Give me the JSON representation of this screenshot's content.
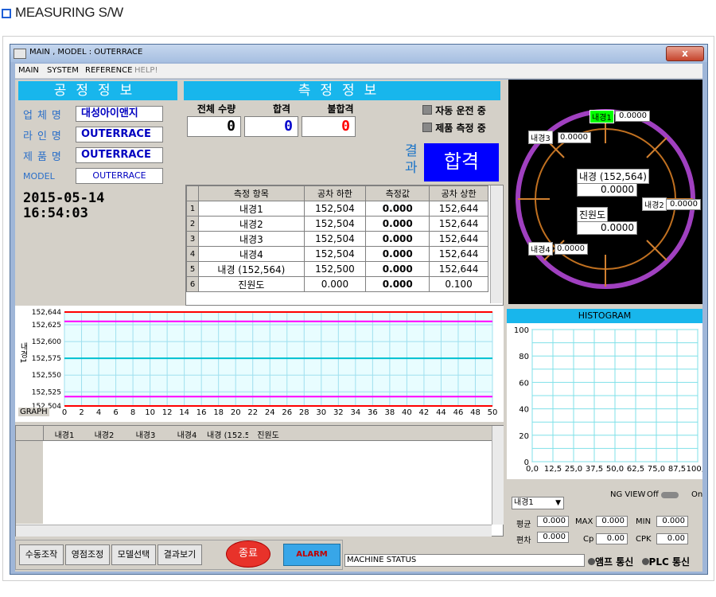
{
  "page_heading": "MEASURING S/W",
  "window": {
    "title": "MAIN ,     MODEL : OUTERRACE",
    "close": "x"
  },
  "menu": [
    "MAIN",
    "SYSTEM",
    "REFERENCE",
    "HELP!"
  ],
  "process_info": {
    "header": "공정정보",
    "rows": [
      {
        "label": "업체명",
        "value": "대성아이앤지"
      },
      {
        "label": "라인명",
        "value": "OUTERRACE"
      },
      {
        "label": "제품명",
        "value": "OUTERRACE"
      },
      {
        "label": "MODEL",
        "value": "OUTERRACE"
      }
    ],
    "date": "2015-05-14",
    "time": "16:54:03"
  },
  "measure_info": {
    "header": "측정정보",
    "counts": [
      {
        "label": "전체 수량",
        "value": "0",
        "color": "#000000"
      },
      {
        "label": "합격",
        "value": "0",
        "color": "#0000cc"
      },
      {
        "label": "불합격",
        "value": "0",
        "color": "#ff0000"
      }
    ],
    "status": [
      "자동 운전 중",
      "제품 측정 중"
    ],
    "result_label_1": "결",
    "result_label_2": "과",
    "result_value": "합격",
    "result_color": "#0000ff"
  },
  "table": {
    "headers": [
      "측정 항목",
      "공차 하한",
      "측정값",
      "공차 상한"
    ],
    "rows": [
      {
        "no": "1",
        "item": "내경1",
        "low": "152,504",
        "val": "0.000",
        "high": "152,644"
      },
      {
        "no": "2",
        "item": "내경2",
        "low": "152,504",
        "val": "0.000",
        "high": "152,644"
      },
      {
        "no": "3",
        "item": "내경3",
        "low": "152,504",
        "val": "0.000",
        "high": "152,644"
      },
      {
        "no": "4",
        "item": "내경4",
        "low": "152,504",
        "val": "0.000",
        "high": "152,644"
      },
      {
        "no": "5",
        "item": "내경 (152,564)",
        "low": "152,500",
        "val": "0.000",
        "high": "152,644"
      },
      {
        "no": "6",
        "item": "진원도",
        "low": "0.000",
        "val": "0.000",
        "high": "0.100"
      }
    ]
  },
  "diagram": {
    "labels": [
      {
        "name": "내경1",
        "value": "0.0000"
      },
      {
        "name": "내경3",
        "value": "0.0000"
      },
      {
        "name": "내경2",
        "value": "0.0000"
      },
      {
        "name": "내경4",
        "value": "0.0000"
      }
    ],
    "center_label": "내경 (152,564)",
    "center_value": "0.0000",
    "round_label": "진원도",
    "round_value": "0.0000"
  },
  "chart_data": [
    {
      "type": "line",
      "ylabel": "내경1",
      "corner_label": "GRAPH",
      "yticks": [
        "152,644",
        "152,625",
        "152,600",
        "152,575",
        "152,550",
        "152,525",
        "152,504"
      ],
      "xticks": [
        "0",
        "2",
        "4",
        "6",
        "8",
        "10",
        "12",
        "14",
        "16",
        "18",
        "20",
        "22",
        "24",
        "26",
        "28",
        "30",
        "32",
        "34",
        "36",
        "38",
        "40",
        "42",
        "44",
        "46",
        "48",
        "50"
      ],
      "xlim": [
        0,
        50
      ],
      "ylim": [
        152.504,
        152.644
      ],
      "series": [
        {
          "color": "#ff0000",
          "x": [
            0,
            50
          ],
          "y": [
            152.644,
            152.644
          ]
        },
        {
          "color": "#ff00ff",
          "x": [
            0,
            50
          ],
          "y": [
            152.63,
            152.63
          ]
        },
        {
          "color": "#00c0d0",
          "x": [
            0,
            50
          ],
          "y": [
            152.575,
            152.575
          ]
        },
        {
          "color": "#ff00ff",
          "x": [
            0,
            50
          ],
          "y": [
            152.518,
            152.518
          ]
        },
        {
          "color": "#ff0000",
          "x": [
            0,
            50
          ],
          "y": [
            152.504,
            152.504
          ]
        }
      ],
      "grid": true
    },
    {
      "type": "bar",
      "title": "HISTOGRAM",
      "yticks": [
        "100",
        "80",
        "60",
        "40",
        "20",
        "0"
      ],
      "xticks": [
        "0,0",
        "12,5",
        "25,0",
        "37,5",
        "50,0",
        "62,5",
        "75,0",
        "87,5",
        "100,0"
      ],
      "ylim": [
        0,
        100
      ],
      "values": [],
      "grid": true
    }
  ],
  "data_grid_headers": [
    "내경1",
    "내경2",
    "내경3",
    "내경4",
    "내경 (152.5",
    "진원도"
  ],
  "stats": {
    "select_value": "내경1",
    "ng_view": "NG VIEW",
    "off": "Off",
    "on": "On",
    "rows": [
      [
        {
          "label": "평균",
          "value": "0.000"
        },
        {
          "label": "MAX",
          "value": "0.000"
        },
        {
          "label": "MIN",
          "value": "0.000"
        }
      ],
      [
        {
          "label": "편차",
          "value": "0.000"
        },
        {
          "label": "Cp",
          "value": "0.00"
        },
        {
          "label": "CPK",
          "value": "0.00"
        }
      ]
    ]
  },
  "buttons": [
    "수동조작",
    "영점조정",
    "모델선택",
    "결과보기"
  ],
  "end_button": "종료",
  "alarm_button": "ALARM",
  "machine_status": "MACHINE STATUS",
  "comm": [
    "앰프 통신",
    "PLC 통신"
  ]
}
